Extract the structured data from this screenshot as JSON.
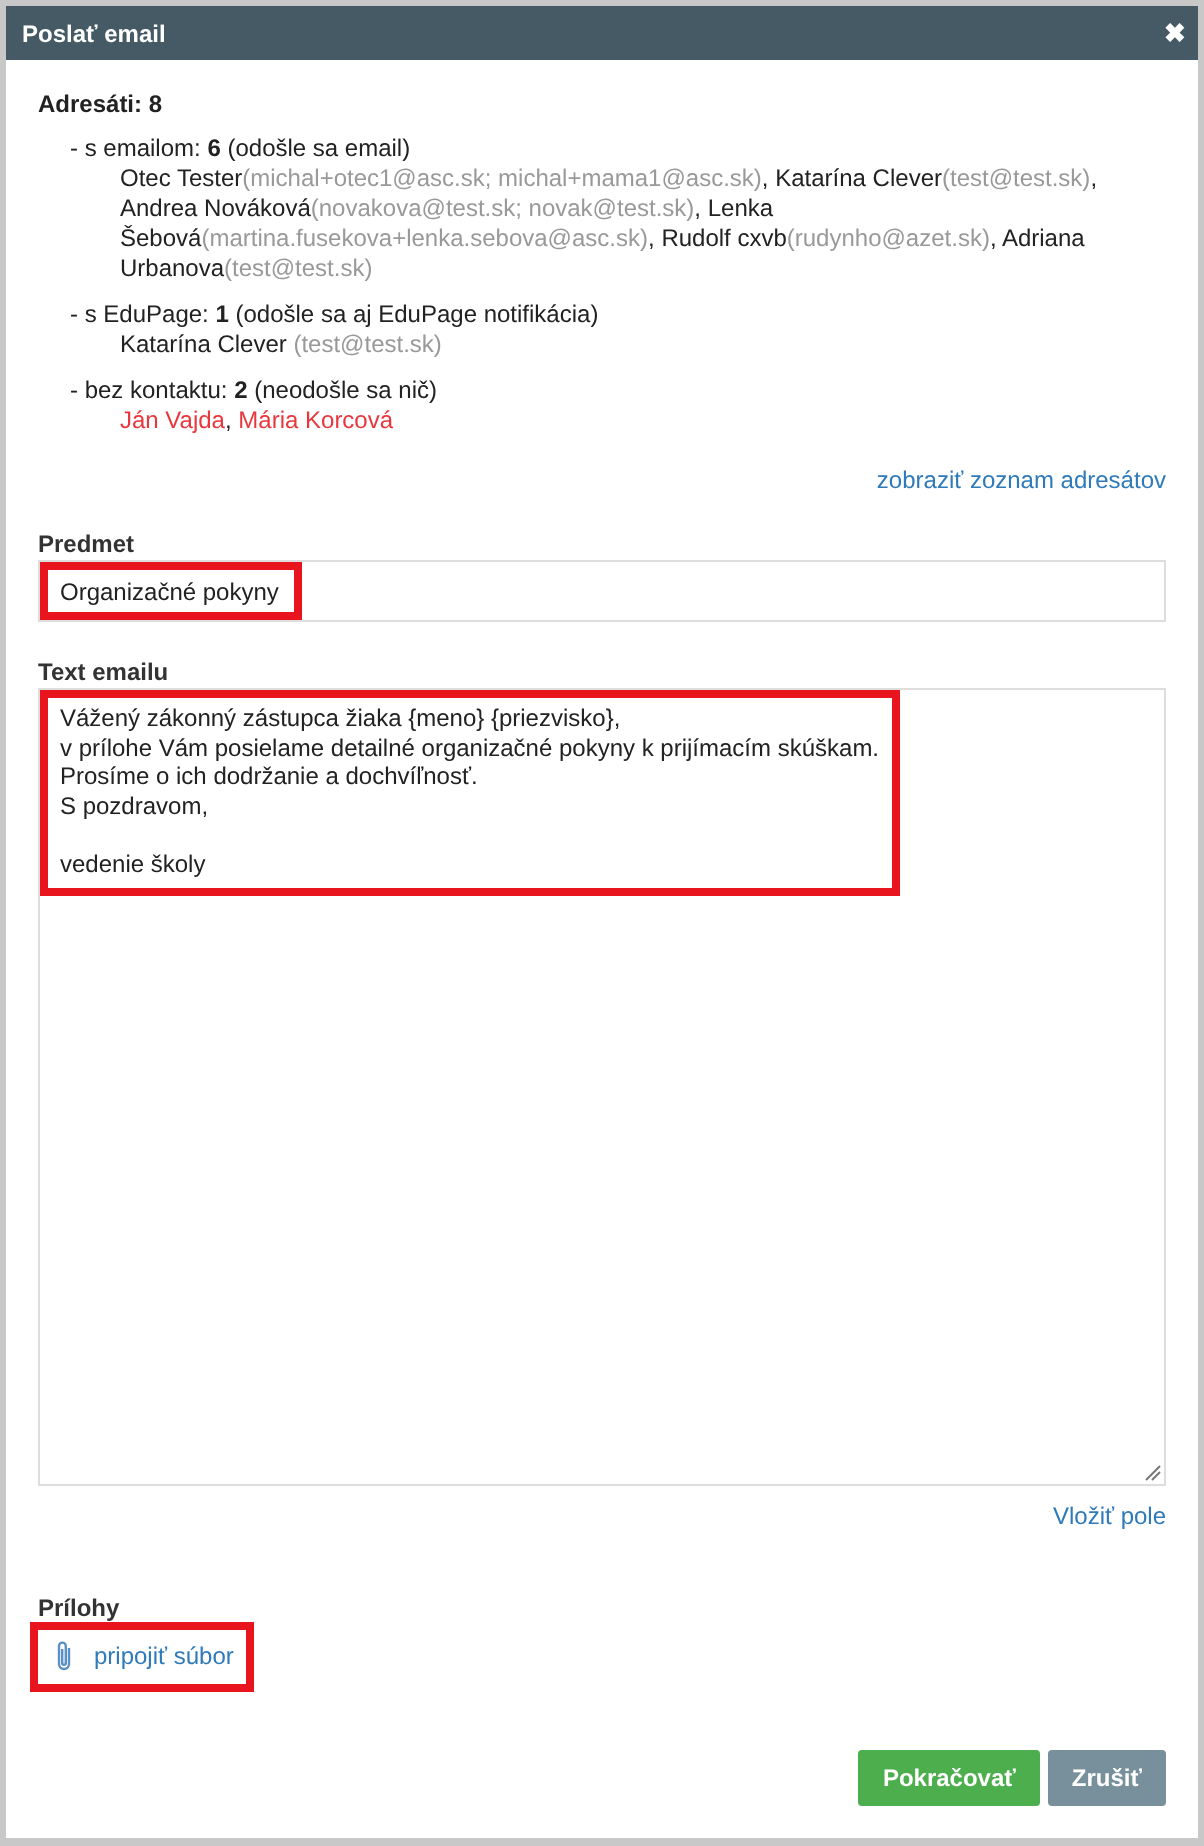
{
  "window": {
    "title": "Poslať email",
    "close": "✖"
  },
  "recipients": {
    "label": "Adresáti:",
    "count": "8",
    "groups": [
      {
        "kind": "email",
        "label": "- s emailom:",
        "count": "6",
        "note": "(odošle sa email)",
        "people": [
          {
            "name": "Otec Tester",
            "contact": "(michal+otec1@asc.sk; michal+mama1@asc.sk)",
            "sep": ","
          },
          {
            "name": "Katarína Clever",
            "contact": "(test@test.sk)",
            "sep": ","
          },
          {
            "name": "Andrea Nováková",
            "contact": "(novakova@test.sk; novak@test.sk)",
            "sep": ","
          },
          {
            "name": "Lenka Šebová",
            "contact": "(martina.fusekova+lenka.sebova@asc.sk)",
            "sep": ","
          },
          {
            "name": "Rudolf cxvb",
            "contact": "(rudynho@azet.sk)",
            "sep": ","
          },
          {
            "name": "Adriana Urbanova",
            "contact": "(test@test.sk)"
          }
        ]
      },
      {
        "kind": "email",
        "label": "- s EduPage:",
        "count": "1",
        "note": "(odošle sa aj EduPage notifikácia)",
        "people": [
          {
            "name": "Katarína Clever",
            "contact": " (test@test.sk)"
          }
        ]
      },
      {
        "kind": "missing",
        "label": "- bez kontaktu:",
        "count": "2",
        "note": "(neodošle sa nič)",
        "people": [
          {
            "name": "Ján Vajda",
            "sep": ","
          },
          {
            "name": "Mária Korcová"
          }
        ]
      }
    ],
    "show_list": "zobraziť zoznam adresátov"
  },
  "subject": {
    "label": "Predmet",
    "value": "Organizačné pokyny",
    "highlighted": true
  },
  "body": {
    "label": "Text emailu",
    "value": "Vážený zákonný zástupca žiaka {meno} {priezvisko},\nv prílohe Vám posielame detailné organizačné pokyny k prijímacím skúškam.\nProsíme o ich dodržanie a dochvíľnosť.\nS pozdravom,\n\nvedenie školy",
    "highlighted": true
  },
  "insert_field": "Vložiť pole",
  "attachments": {
    "label": "Prílohy",
    "link": "pripojiť súbor",
    "highlighted": true
  },
  "buttons": [
    {
      "label": "Pokračovať",
      "kind": "primary"
    },
    {
      "label": "Zrušiť",
      "kind": "secondary"
    }
  ]
}
